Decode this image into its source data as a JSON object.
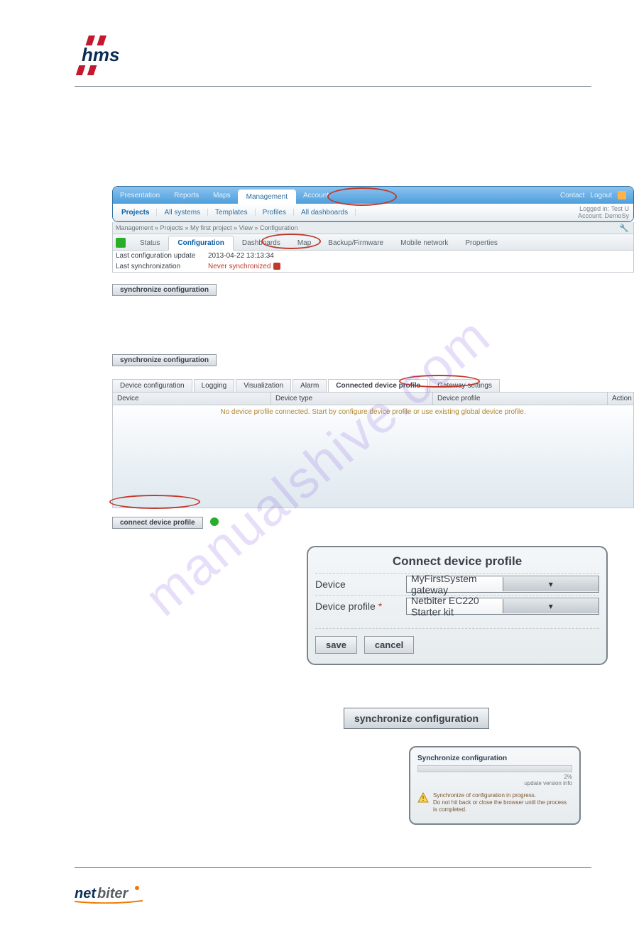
{
  "header": {
    "logo_alt": "HMS"
  },
  "argos": {
    "topnav": {
      "items": [
        "Presentation",
        "Reports",
        "Maps",
        "Management",
        "Account"
      ],
      "active_index": 3,
      "right": {
        "contact": "Contact",
        "logout": "Logout"
      }
    },
    "subnav": {
      "items": [
        "Projects",
        "All systems",
        "Templates",
        "Profiles",
        "All dashboards"
      ],
      "account_line1": "Logged in: Test U",
      "account_line2": "Account: DemoSy"
    },
    "breadcrumb": "Management » Projects » My first project » View » Configuration",
    "inner_tabs": {
      "items": [
        "Status",
        "Configuration",
        "Dashboards",
        "Map",
        "Backup/Firmware",
        "Mobile network",
        "Properties"
      ],
      "active_index": 1
    },
    "kv": {
      "last_config_label": "Last configuration update",
      "last_config_value": "2013-04-22 13:13:34",
      "last_sync_label": "Last synchronization",
      "last_sync_value": "Never synchronized"
    },
    "sync_btn": "synchronize configuration"
  },
  "device_section": {
    "sync_btn": "synchronize configuration",
    "tabs": [
      "Device configuration",
      "Logging",
      "Visualization",
      "Alarm",
      "Connected device profile",
      "Gateway settings"
    ],
    "active_tab_index": 4,
    "table": {
      "headers": {
        "device": "Device",
        "type": "Device type",
        "profile": "Device profile",
        "action": "Action"
      },
      "empty_msg": "No device profile connected. Start by configure device profile or use existing global device profile."
    },
    "connect_btn": "connect device profile"
  },
  "dialog": {
    "title": "Connect device profile",
    "device_label": "Device",
    "device_value": "MyFirstSystem gateway",
    "profile_label": "Device profile",
    "profile_required": "*",
    "profile_value": "Netbiter EC220 Starter kit",
    "save": "save",
    "cancel": "cancel"
  },
  "big_sync_btn": "synchronize configuration",
  "progress": {
    "title": "Synchronize configuration",
    "percent": "2%",
    "sub": "update version info",
    "warn_line1": "Synchronize of configuration in progress.",
    "warn_line2": "Do not hit back or close the browser until the process is completed."
  },
  "footer": {
    "logo_alt": "netbiter"
  },
  "watermark": "manualshive.com"
}
